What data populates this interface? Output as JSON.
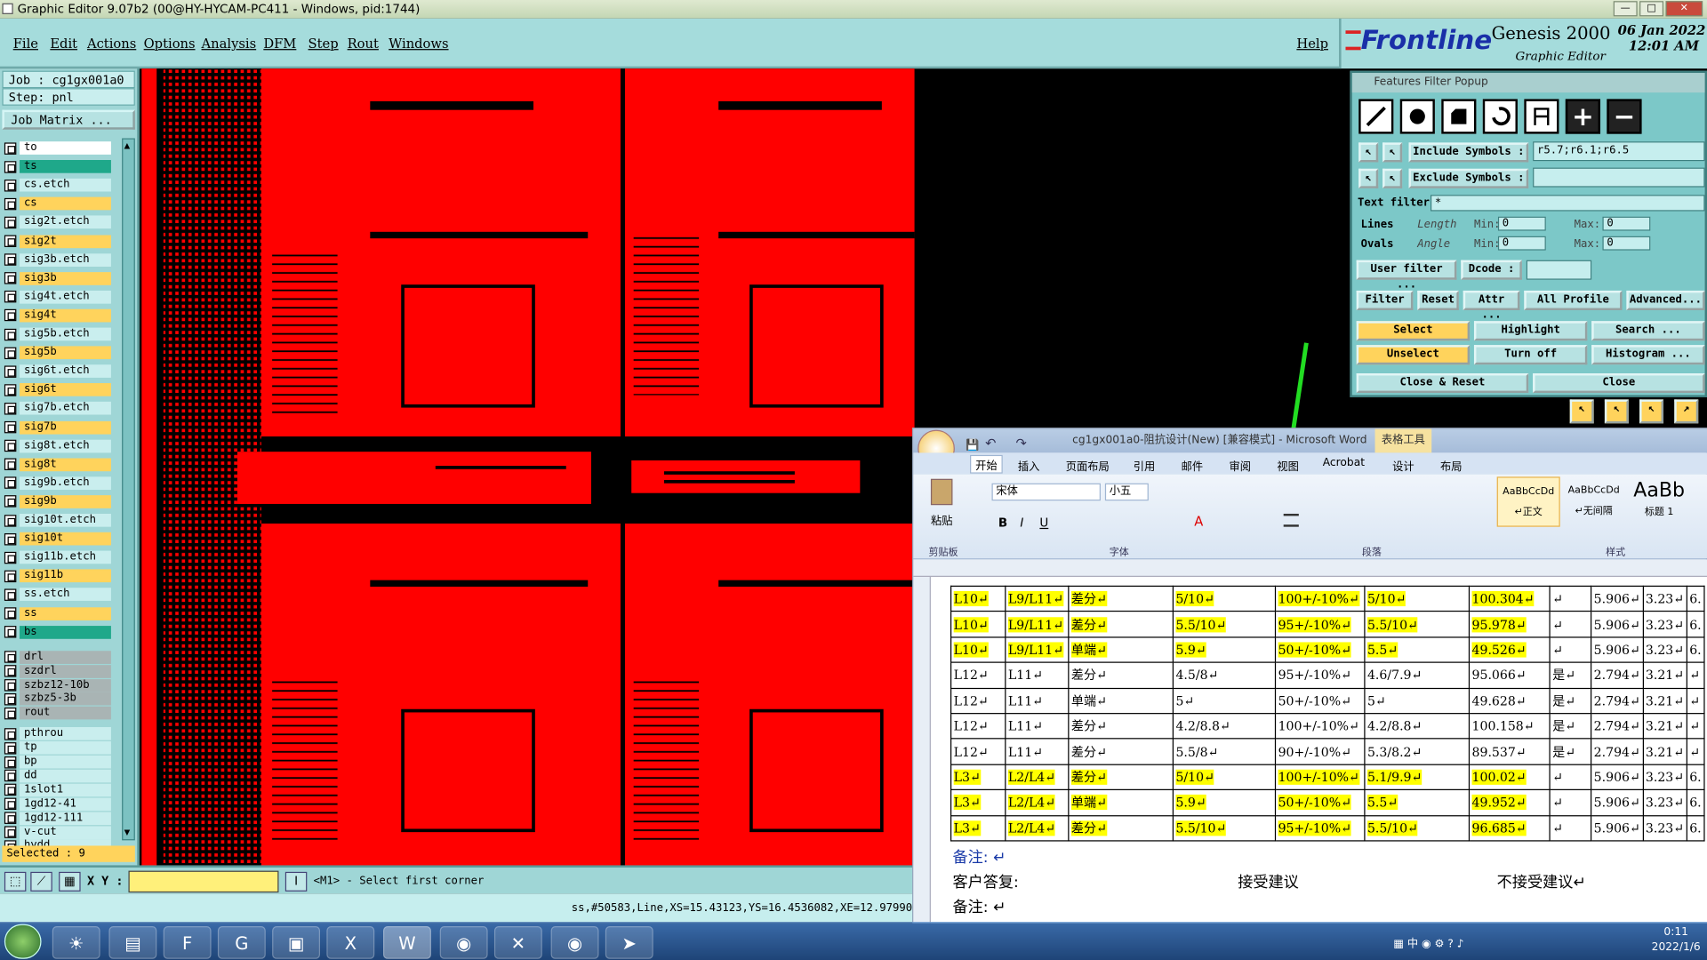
{
  "window": {
    "title": "Graphic Editor 9.07b2 (00@HY-HYCAM-PC411 - Windows, pid:1744)"
  },
  "menu": [
    "File",
    "Edit",
    "Actions",
    "Options",
    "Analysis",
    "DFM",
    "Step",
    "Rout",
    "Windows"
  ],
  "help": "Help",
  "brand": {
    "logo": "Frontline",
    "product": "Genesis 2000",
    "subtitle": "Graphic Editor",
    "date": "06 Jan 2022",
    "time": "12:01 AM"
  },
  "job": {
    "job": "Job : cg1gx001a0",
    "step": "Step: pnl",
    "matrix": "Job Matrix ..."
  },
  "layers": [
    {
      "name": "to",
      "color": "#ffffff"
    },
    {
      "name": "ts",
      "color": "#1fa88a"
    },
    {
      "name": "cs.etch",
      "color": "#c9eeee"
    },
    {
      "name": "cs",
      "color": "#ffd35c"
    },
    {
      "name": "sig2t.etch",
      "color": "#c9eeee"
    },
    {
      "name": "sig2t",
      "color": "#ffd35c"
    },
    {
      "name": "sig3b.etch",
      "color": "#c9eeee"
    },
    {
      "name": "sig3b",
      "color": "#ffd35c"
    },
    {
      "name": "sig4t.etch",
      "color": "#c9eeee"
    },
    {
      "name": "sig4t",
      "color": "#ffd35c"
    },
    {
      "name": "sig5b.etch",
      "color": "#c9eeee"
    },
    {
      "name": "sig5b",
      "color": "#ffd35c"
    },
    {
      "name": "sig6t.etch",
      "color": "#c9eeee"
    },
    {
      "name": "sig6t",
      "color": "#ffd35c"
    },
    {
      "name": "sig7b.etch",
      "color": "#c9eeee"
    },
    {
      "name": "sig7b",
      "color": "#ffd35c"
    },
    {
      "name": "sig8t.etch",
      "color": "#c9eeee"
    },
    {
      "name": "sig8t",
      "color": "#ffd35c"
    },
    {
      "name": "sig9b.etch",
      "color": "#c9eeee"
    },
    {
      "name": "sig9b",
      "color": "#ffd35c"
    },
    {
      "name": "sig10t.etch",
      "color": "#c9eeee"
    },
    {
      "name": "sig10t",
      "color": "#ffd35c"
    },
    {
      "name": "sig11b.etch",
      "color": "#c9eeee"
    },
    {
      "name": "sig11b",
      "color": "#ffd35c"
    },
    {
      "name": "ss.etch",
      "color": "#c9eeee"
    },
    {
      "name": "ss",
      "color": "#ffd35c"
    },
    {
      "name": "bs",
      "color": "#1fa88a"
    },
    {
      "name": "drl",
      "color": "#a9b4b4"
    },
    {
      "name": "szdrl",
      "color": "#a9b4b4"
    },
    {
      "name": "szbz12-10b",
      "color": "#a9b4b4"
    },
    {
      "name": "szbz5-3b",
      "color": "#a9b4b4"
    },
    {
      "name": "rout",
      "color": "#a9b4b4"
    },
    {
      "name": "pthrou",
      "color": "#c9eeee"
    },
    {
      "name": "tp",
      "color": "#c9eeee"
    },
    {
      "name": "bp",
      "color": "#c9eeee"
    },
    {
      "name": "dd",
      "color": "#c9eeee"
    },
    {
      "name": "1slot1",
      "color": "#c9eeee"
    },
    {
      "name": "1gd12-41",
      "color": "#c9eeee"
    },
    {
      "name": "1gd12-111",
      "color": "#c9eeee"
    },
    {
      "name": "v-cut",
      "color": "#c9eeee"
    },
    {
      "name": "hydd",
      "color": "#c9eeee"
    }
  ],
  "selected_text": "Selected : 9",
  "status": {
    "xy_label": "X Y :",
    "prompt": "<M1> - Select first corner",
    "coord": "ss,#50583,Line,XS=15.43123,YS=16.4536082,XE=12.97990"
  },
  "filter": {
    "title": "Features Filter Popup",
    "include_label": "Include Symbols :",
    "include_value": "r5.7;r6.1;r6.5",
    "exclude_label": "Exclude Symbols :",
    "exclude_value": "",
    "text_filter_label": "Text filter",
    "text_filter_value": "*",
    "lines": "Lines",
    "ovals": "Ovals",
    "length": "Length",
    "angle": "Angle",
    "min": "Min:",
    "max": "Max:",
    "zero": "0",
    "user_filter": "User filter ...",
    "dcode": "Dcode :",
    "filter": "Filter",
    "reset": "Reset",
    "attr": "Attr ...",
    "all_profile": "All Profile",
    "advanced": "Advanced...",
    "select": "Select",
    "highlight": "Highlight",
    "search": "Search ...",
    "unselect": "Unselect",
    "turn_off": "Turn off",
    "histogram": "Histogram ...",
    "close_reset": "Close & Reset",
    "close": "Close"
  },
  "word": {
    "title": "cg1gx001a0-阻抗设计(New) [兼容模式] - Microsoft Word",
    "table_tools": "表格工具",
    "tabs": [
      "开始",
      "插入",
      "页面布局",
      "引用",
      "邮件",
      "审阅",
      "视图",
      "Acrobat",
      "设计",
      "布局"
    ],
    "font": "宋体",
    "size": "小五",
    "paste": "粘贴",
    "clipboard": "剪贴板",
    "font_group": "字体",
    "para_group": "段落",
    "style_group": "样式",
    "styles": [
      {
        "sample": "AaBbCcDd",
        "name": "↵正文"
      },
      {
        "sample": "AaBbCcDd",
        "name": "↵无间隔"
      },
      {
        "sample": "AaBb",
        "name": "标题 1"
      }
    ],
    "rows": [
      {
        "hl": true,
        "c": [
          "L10↵",
          "L9/L11↵",
          "差分↵",
          "5/10↵",
          "100+/-10%↵",
          "5/10↵",
          "100.304↵",
          "↵",
          "5.906↵",
          "3.23↵",
          "6."
        ]
      },
      {
        "hl": true,
        "c": [
          "L10↵",
          "L9/L11↵",
          "差分↵",
          "5.5/10↵",
          "95+/-10%↵",
          "5.5/10↵",
          "95.978↵",
          "↵",
          "5.906↵",
          "3.23↵",
          "6."
        ]
      },
      {
        "hl": true,
        "c": [
          "L10↵",
          "L9/L11↵",
          "单端↵",
          "5.9↵",
          "50+/-10%↵",
          "5.5↵",
          "49.526↵",
          "↵",
          "5.906↵",
          "3.23↵",
          "6."
        ]
      },
      {
        "hl": false,
        "c": [
          "L12↵",
          "L11↵",
          "差分↵",
          "4.5/8↵",
          "95+/-10%↵",
          "4.6/7.9↵",
          "95.066↵",
          "是↵",
          "2.794↵",
          "3.21↵",
          "↵"
        ]
      },
      {
        "hl": false,
        "c": [
          "L12↵",
          "L11↵",
          "单端↵",
          "5↵",
          "50+/-10%↵",
          "5↵",
          "49.628↵",
          "是↵",
          "2.794↵",
          "3.21↵",
          "↵"
        ]
      },
      {
        "hl": false,
        "c": [
          "L12↵",
          "L11↵",
          "差分↵",
          "4.2/8.8↵",
          "100+/-10%↵",
          "4.2/8.8↵",
          "100.158↵",
          "是↵",
          "2.794↵",
          "3.21↵",
          "↵"
        ]
      },
      {
        "hl": false,
        "c": [
          "L12↵",
          "L11↵",
          "差分↵",
          "5.5/8↵",
          "90+/-10%↵",
          "5.3/8.2↵",
          "89.537↵",
          "是↵",
          "2.794↵",
          "3.21↵",
          "↵"
        ]
      },
      {
        "hl": true,
        "c": [
          "L3↵",
          "L2/L4↵",
          "差分↵",
          "5/10↵",
          "100+/-10%↵",
          "5.1/9.9↵",
          "100.02↵",
          "↵",
          "5.906↵",
          "3.23↵",
          "6."
        ]
      },
      {
        "hl": true,
        "c": [
          "L3↵",
          "L2/L4↵",
          "单端↵",
          "5.9↵",
          "50+/-10%↵",
          "5.5↵",
          "49.952↵",
          "↵",
          "5.906↵",
          "3.23↵",
          "6."
        ]
      },
      {
        "hl": true,
        "c": [
          "L3↵",
          "L2/L4↵",
          "差分↵",
          "5.5/10↵",
          "95+/-10%↵",
          "5.5/10↵",
          "96.685↵",
          "↵",
          "5.906↵",
          "3.23↵",
          "6."
        ]
      }
    ],
    "note1": "备注: ↵",
    "reply": "客户答复:",
    "accept": "接受建议",
    "reject": "不接受建议↵",
    "note2": "备注: ↵"
  },
  "clock": {
    "time": "0:11",
    "date": "2022/1/6"
  },
  "colors": {
    "board_red": "#ff0000",
    "panel_cyan": "#9fd6d6",
    "highlight_yellow": "#ffff00",
    "arrow_green": "#22dd22"
  }
}
